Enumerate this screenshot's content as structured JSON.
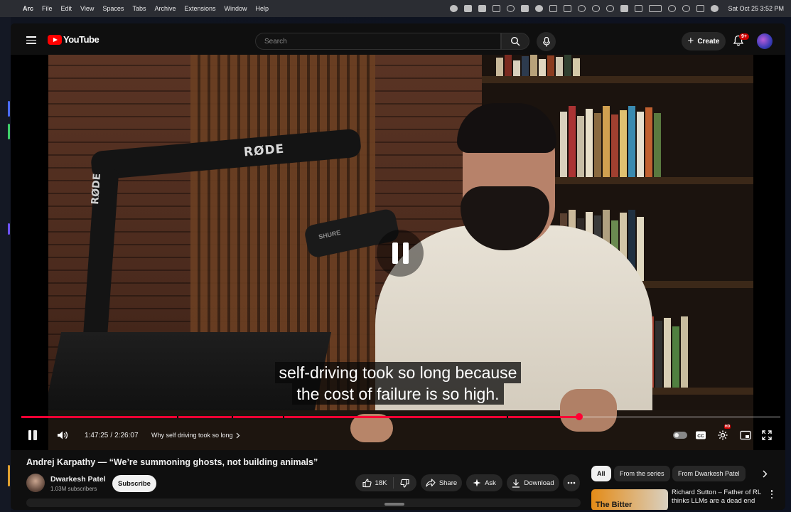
{
  "menubar": {
    "app": "Arc",
    "items": [
      "File",
      "Edit",
      "View",
      "Spaces",
      "Tabs",
      "Archive",
      "Extensions",
      "Window",
      "Help"
    ],
    "clock": "Sat Oct 25  3:52 PM"
  },
  "topbar": {
    "logo": "YouTube",
    "search_placeholder": "Search",
    "create_label": "Create",
    "notifications_badge": "9+"
  },
  "player": {
    "caption_line1": "self-driving took so long because",
    "caption_line2": "the cost of failure is so high.",
    "time_current": "1:47:25",
    "time_separator": "/",
    "time_total": "2:26:07",
    "chapter_title": "Why self driving took so long",
    "progress_fraction": 0.735,
    "video_brand_text": "RØDE",
    "mic_brand_text": "SHURE"
  },
  "video": {
    "title": "Andrej Karpathy — “We’re summoning ghosts, not building animals”",
    "channel_name": "Dwarkesh Patel",
    "subscribers": "1.03M subscribers",
    "subscribe_label": "Subscribe",
    "like_count": "18K",
    "share_label": "Share",
    "ask_label": "Ask",
    "download_label": "Download"
  },
  "sidebar": {
    "chips": [
      "All",
      "From the series",
      "From Dwarkesh Patel"
    ],
    "rec_thumb_text": "The Bitter",
    "rec_title": "Richard Sutton – Father of RL thinks LLMs are a dead end"
  },
  "colors": {
    "accent": "#ff0033",
    "youtube_red": "#ff0000",
    "background": "#0f0f0f"
  }
}
